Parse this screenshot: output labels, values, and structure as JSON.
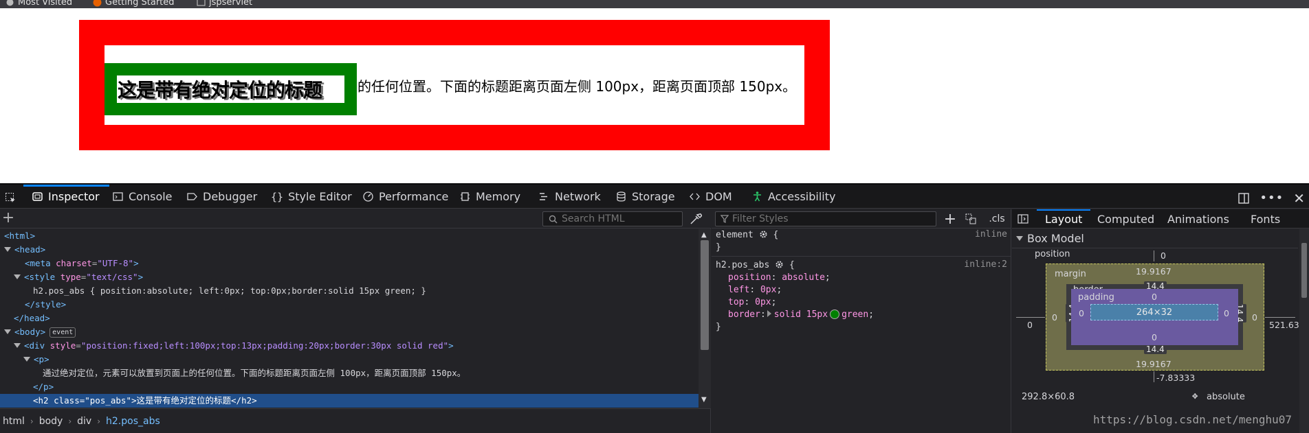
{
  "bookmarks": [
    {
      "label": "Most Visited",
      "icon": "gear-icon"
    },
    {
      "label": "Getting Started",
      "icon": "firefox-icon"
    },
    {
      "label": "jspservlet",
      "icon": "folder-icon"
    }
  ],
  "page": {
    "paragraph_text": "的任何位置。下面的标题距离页面左侧 100px，距离页面顶部 150px。",
    "heading_text": "这是带有绝对定位的标题",
    "colors": {
      "fixed_border": "#ff0000",
      "heading_border": "#008000"
    }
  },
  "devtools": {
    "tabs": [
      {
        "label": "Inspector",
        "icon": "inspector-icon",
        "active": true
      },
      {
        "label": "Console",
        "icon": "console-icon"
      },
      {
        "label": "Debugger",
        "icon": "debugger-icon"
      },
      {
        "label": "Style Editor",
        "icon": "braces-icon"
      },
      {
        "label": "Performance",
        "icon": "gauge-icon"
      },
      {
        "label": "Memory",
        "icon": "memory-icon"
      },
      {
        "label": "Network",
        "icon": "network-icon"
      },
      {
        "label": "Storage",
        "icon": "storage-icon"
      },
      {
        "label": "DOM",
        "icon": "code-icon"
      },
      {
        "label": "Accessibility",
        "icon": "accessibility-icon"
      }
    ],
    "markup": {
      "search_placeholder": "Search HTML",
      "lines": [
        {
          "open": "<html>"
        },
        {
          "open": "<head>"
        },
        {
          "tag": "<meta ",
          "attr": "charset",
          "eq": "=",
          "val": "\"UTF-8\"",
          "close": ">"
        },
        {
          "tag": "<style ",
          "attr": "type",
          "eq": "=",
          "val": "\"text/css\"",
          "close": ">"
        },
        {
          "text": "h2.pos_abs { position:absolute; left:0px; top:0px;border:solid 15px green; }"
        },
        {
          "open": "</style>"
        },
        {
          "open": "</head>"
        },
        {
          "open": "<body>",
          "badge": "event"
        },
        {
          "tag": "<div ",
          "attr": "style",
          "eq": "=",
          "val": "\"position:fixed;left:100px;top:13px;padding:20px;border:30px solid red\"",
          "close": ">"
        },
        {
          "open": "<p>"
        },
        {
          "text": "通过绝对定位，元素可以放置到页面上的任何位置。下面的标题距离页面左侧 100px，距离页面顶部 150px。"
        },
        {
          "open": "</p>"
        },
        {
          "selected": "<h2 class=\"pos_abs\">这是带有绝对定位的标题</h2>"
        }
      ],
      "breadcrumbs": [
        "html",
        "body",
        "div",
        "h2.pos_abs"
      ]
    },
    "rules": {
      "filter_placeholder": "Filter Styles",
      "cls_label": ".cls",
      "element_rule": {
        "selector": "element",
        "source": "inline",
        "open": "{",
        "close": "}"
      },
      "h2_rule": {
        "selector": "h2.pos_abs",
        "source": "inline:2",
        "open": "{",
        "close": "}",
        "declarations": [
          {
            "prop": "position",
            "value": "absolute"
          },
          {
            "prop": "left",
            "value": "0px"
          },
          {
            "prop": "top",
            "value": "0px"
          },
          {
            "prop": "border",
            "value_pre": "solid 15px",
            "value_post": "green"
          }
        ],
        "swatch_color": "#008000"
      }
    },
    "sidebar": {
      "tabs": [
        "Layout",
        "Computed",
        "Animations",
        "Fonts"
      ],
      "active_tab": "Layout",
      "box_model_title": "Box Model",
      "box_model": {
        "position_label": "position",
        "position_top": "0",
        "position_left": "0",
        "position_right": "521.63",
        "position_bottom": "-7.83333",
        "margin_label": "margin",
        "margin_top": "19.9167",
        "margin_bottom": "19.9167",
        "margin_left": "0",
        "margin_right": "0",
        "border_label": "border",
        "border_top": "14.4",
        "border_bottom": "14.4",
        "border_left": "14.4",
        "border_right": "14.4",
        "padding_label": "padding",
        "padding_top": "0",
        "padding_bottom": "0",
        "padding_left": "0",
        "padding_right": "0",
        "content": "264×32",
        "element_size": "292.8×60.8",
        "position_value": "absolute"
      }
    }
  },
  "watermark": "https://blog.csdn.net/menghu07"
}
